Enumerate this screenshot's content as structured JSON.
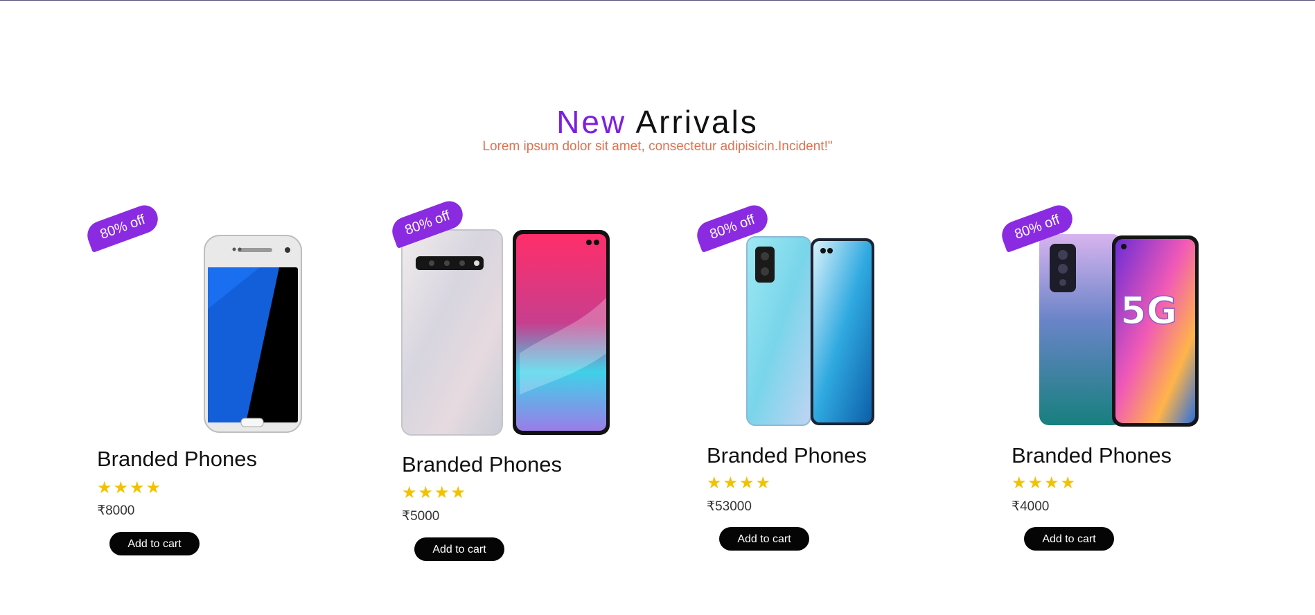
{
  "section": {
    "title_accent": "New",
    "title_rest": "Arrivals",
    "subtitle": "Lorem ipsum dolor sit amet, consectetur adipisicin.Incident!\""
  },
  "colors": {
    "accent": "#7b1fe0",
    "badge": "#8a2be2",
    "subtitle": "#e0724f",
    "star": "#f2c200",
    "button": "#050505"
  },
  "products": [
    {
      "badge": "80% off",
      "name": "Branded Phones",
      "rating": 4,
      "stars": "★★★★",
      "price": "₹8000",
      "cta": "Add to cart",
      "image": "samsung-galaxy-s7-white"
    },
    {
      "badge": "80% off",
      "name": "Branded Phones",
      "rating": 4,
      "stars": "★★★★",
      "price": "₹5000",
      "cta": "Add to cart",
      "image": "samsung-galaxy-s10-silver"
    },
    {
      "badge": "80% off",
      "name": "Branded Phones",
      "rating": 4,
      "stars": "★★★★",
      "price": "₹53000",
      "cta": "Add to cart",
      "image": "infinix-phone-blue"
    },
    {
      "badge": "80% off",
      "name": "Branded Phones",
      "rating": 4,
      "stars": "★★★★",
      "price": "₹4000",
      "cta": "Add to cart",
      "image": "oppo-5g-gradient"
    }
  ]
}
